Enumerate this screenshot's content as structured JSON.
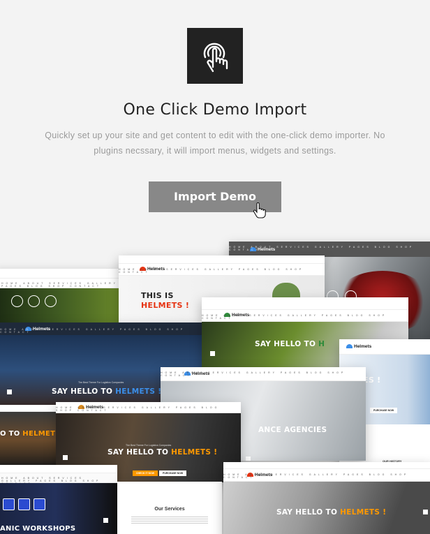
{
  "feature": {
    "icon": "touch-click-icon",
    "title": "One Click Demo Import",
    "description_line1": "Quickly set up your site and get content to edit with the one-click demo importer. No",
    "description_line2": "plugins necssary, it will import menus, widgets and settings.",
    "button_label": "Import Demo",
    "cursor": "hand-pointer-icon"
  },
  "brand": {
    "name": "Helmets",
    "accent": "#ff9900",
    "blue": "#3b8ee8",
    "red": "#e63312"
  },
  "screens": {
    "nav_links": "HOME ABOUT SERVICES GALLERY PAGES BLOG SHOP CONTACT",
    "tagline": "The Best Theme For Logistics Companies",
    "say_hello": "SAY HELLO TO",
    "helmets": "HELMETS !",
    "this_is": "THIS IS",
    "helmets_caps": "HELMETS !",
    "insurance": "ANCE AGENCIES",
    "workshops": "ANIC WORKSHOPS",
    "our_services": "Our Services",
    "our_history": "OUR HISTORY",
    "purchase": "PURCHASE NOW",
    "check_it": "CHECK IT NOW",
    "es": "ES !"
  }
}
